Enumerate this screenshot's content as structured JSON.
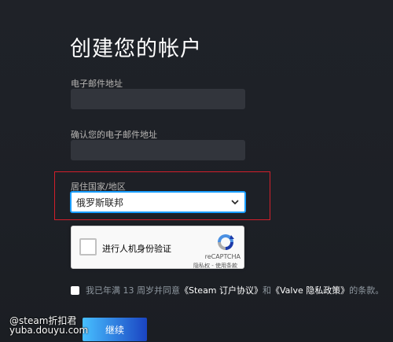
{
  "page": {
    "title": "创建您的帐户"
  },
  "form": {
    "email_label": "电子邮件地址",
    "email_value": "",
    "confirm_email_label": "确认您的电子邮件地址",
    "confirm_email_value": "",
    "country_label": "居住国家/地区",
    "country_value": "俄罗斯联邦"
  },
  "recaptcha": {
    "checkbox_label": "进行人机身份验证",
    "brand": "reCAPTCHA",
    "privacy": "隐私权",
    "separator": " - ",
    "terms": "使用条款"
  },
  "agreement": {
    "prefix": "我已年满 13 周岁并同意",
    "steam_link": "《Steam 订户协议》",
    "and": "和",
    "valve_link": "《Valve 隐私政策》",
    "suffix": "的条款。"
  },
  "buttons": {
    "continue": "继续"
  },
  "watermark": {
    "line1": "@steam折扣君",
    "line2": "yuba.douyu.com"
  },
  "colors": {
    "accent_blue": "#1a9fff",
    "highlight_red": "#d21f2a"
  }
}
